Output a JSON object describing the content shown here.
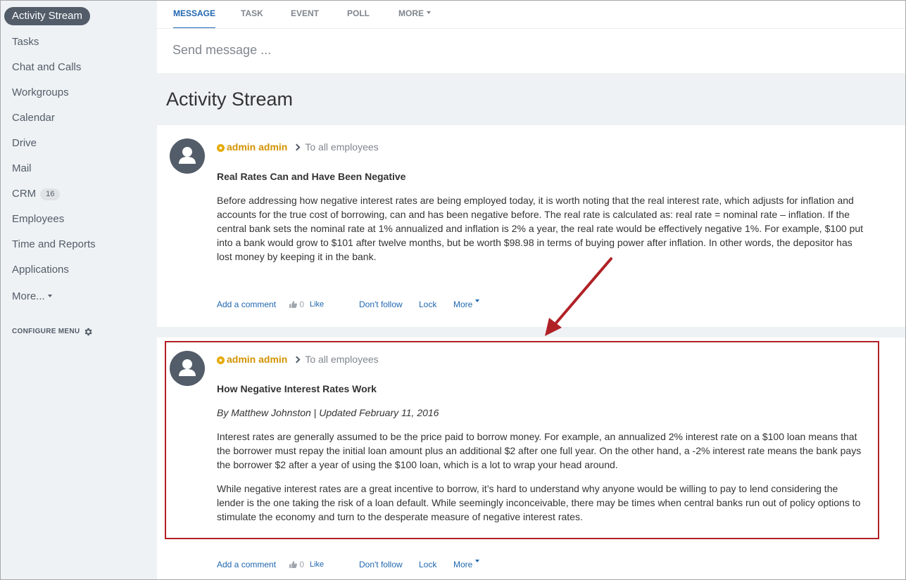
{
  "sidebar": {
    "items": [
      {
        "label": "Activity Stream",
        "active": true
      },
      {
        "label": "Tasks"
      },
      {
        "label": "Chat and Calls"
      },
      {
        "label": "Workgroups"
      },
      {
        "label": "Calendar"
      },
      {
        "label": "Drive"
      },
      {
        "label": "Mail"
      },
      {
        "label": "CRM",
        "badge": "16"
      },
      {
        "label": "Employees"
      },
      {
        "label": "Time and Reports"
      },
      {
        "label": "Applications"
      },
      {
        "label": "More..."
      }
    ],
    "configure_label": "CONFIGURE MENU"
  },
  "composer": {
    "tabs": [
      "MESSAGE",
      "TASK",
      "EVENT",
      "POLL",
      "MORE"
    ],
    "placeholder": "Send message ..."
  },
  "page_title": "Activity Stream",
  "posts": [
    {
      "author": "admin admin",
      "destination": "To all employees",
      "title": "Real Rates Can and Have Been Negative",
      "paragraphs": [
        "Before addressing how negative interest rates are being employed today, it is worth noting that the real interest rate, which adjusts for inflation and accounts for the true cost of borrowing, can and has been negative before. The real rate is calculated as: real rate = nominal rate – inflation. If the central bank sets the nominal rate at 1% annualized and inflation is 2% a year, the real rate would be effectively negative 1%. For example, $100 put into a bank would grow to $101 after twelve months, but be worth $98.98 in terms of buying power after inflation. In other words, the depositor has lost money by keeping it in the bank."
      ],
      "actions": {
        "comment": "Add a comment",
        "likes": "0",
        "like": "Like",
        "follow": "Don't follow",
        "lock": "Lock",
        "more": "More"
      }
    },
    {
      "author": "admin admin",
      "destination": "To all employees",
      "title": "How Negative Interest Rates Work",
      "byline_author": "By Matthew Johnston",
      "byline_sep": " | ",
      "byline_date": "Updated February 11, 2016",
      "paragraphs": [
        "Interest rates are generally assumed to be the price paid to borrow money. For example, an annualized 2% interest rate on a $100 loan means that the borrower must repay the initial loan amount plus an additional $2 after one full year. On the other hand, a -2% interest rate means the bank pays the borrower $2 after a year of using the $100 loan, which is a lot to wrap your head around.",
        "While negative interest rates are a great incentive to borrow, it’s hard to understand why anyone would be willing to pay to lend considering the lender is the one taking the risk of a loan default. While seemingly inconceivable, there may be times when central banks run out of policy options to stimulate the economy and turn to the desperate measure of negative interest rates."
      ],
      "actions": {
        "comment": "Add a comment",
        "likes": "0",
        "like": "Like",
        "follow": "Don't follow",
        "lock": "Lock",
        "more": "More"
      }
    }
  ],
  "colors": {
    "accent": "#2067b0",
    "author": "#d29200",
    "highlight": "#b02126",
    "sidebar_bg": "#eef2f4"
  }
}
